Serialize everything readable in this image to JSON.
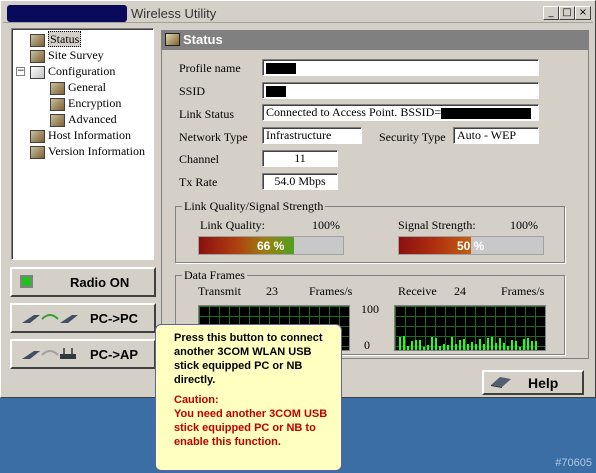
{
  "window": {
    "title": "Wireless Utility",
    "buttons": {
      "minimize": "_",
      "maximize": "□",
      "close": "×"
    }
  },
  "tree": {
    "items": [
      {
        "label": "Status"
      },
      {
        "label": "Site Survey"
      },
      {
        "label": "Configuration"
      },
      {
        "label": "General"
      },
      {
        "label": "Encryption"
      },
      {
        "label": "Advanced"
      },
      {
        "label": "Host Information"
      },
      {
        "label": "Version Information"
      }
    ]
  },
  "left_buttons": {
    "radio": "Radio ON",
    "pc_pc": "PC->PC",
    "pc_ap": "PC->AP"
  },
  "status": {
    "header": "Status",
    "profile_name_label": "Profile name",
    "ssid_label": "SSID",
    "link_status_label": "Link Status",
    "link_status_value": "Connected to Access Point. BSSID=",
    "network_type_label": "Network Type",
    "network_type_value": "Infrastructure",
    "security_type_label": "Security Type",
    "security_type_value": "Auto - WEP",
    "channel_label": "Channel",
    "channel_value": "11",
    "tx_rate_label": "Tx Rate",
    "tx_rate_value": "54.0 Mbps"
  },
  "link_quality": {
    "group_title": "Link Quality/Signal Strength",
    "quality_label": "Link Quality:",
    "quality_max": "100%",
    "quality_text": "66 %",
    "quality_fraction": 0.66,
    "signal_label": "Signal Strength:",
    "signal_max": "100%",
    "signal_text": "50 %",
    "signal_fraction": 0.5
  },
  "data_frames": {
    "group_title": "Data Frames",
    "transmit_label": "Transmit",
    "transmit_value": "23",
    "transmit_unit": "Frames/s",
    "receive_label": "Receive",
    "receive_value": "24",
    "receive_unit": "Frames/s",
    "scale_max": "100",
    "scale_min": "0"
  },
  "help_button": "Help",
  "tooltip": {
    "text": "Press this button to connect another 3COM WLAN USB stick equipped PC or NB directly.",
    "caution_title": "Caution:",
    "caution_text": "You need another 3COM USB stick equipped PC or NB to enable this function."
  },
  "watermark": "#70605",
  "colors": {
    "accent_green": "#20c020",
    "tooltip_bg": "#ffffc0",
    "caution": "#c00000"
  }
}
